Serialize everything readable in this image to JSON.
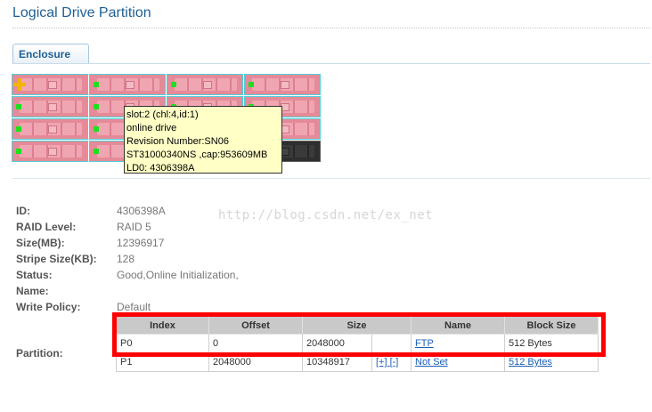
{
  "page": {
    "title": "Logical Drive Partition"
  },
  "tabs": [
    {
      "label": "Enclosure"
    }
  ],
  "colors": {
    "highlight": "#ff0000",
    "link": "#1a5fb4",
    "title": "#1f5f95",
    "drive_led": "#1ee01e",
    "add_marker": "#f3b400"
  },
  "tooltip": {
    "lines": [
      "slot:2 (chl:4,id:1)",
      "online drive",
      "Revision Number:SN06",
      "ST31000340NS ,cap:953609MB",
      "LD0: 4306398A"
    ]
  },
  "watermark": "http://blog.csdn.net/ex_net",
  "drive_info": [
    {
      "label": "ID:",
      "value": "4306398A"
    },
    {
      "label": "RAID Level:",
      "value": "RAID 5"
    },
    {
      "label": "Size(MB):",
      "value": "12396917"
    },
    {
      "label": "Stripe Size(KB):",
      "value": "128"
    },
    {
      "label": "Status:",
      "value": "Good,Online Initialization,"
    },
    {
      "label": "Name:",
      "value": ""
    },
    {
      "label": "Write Policy:",
      "value": "Default"
    }
  ],
  "partition": {
    "label": "Partition:",
    "columns": [
      "Index",
      "Offset",
      "Size",
      "Name",
      "Block Size"
    ],
    "rows": [
      {
        "index": "P0",
        "offset": "0",
        "size": "2048000",
        "controls": "",
        "name": "FTP",
        "block_size": "512 Bytes"
      },
      {
        "index": "P1",
        "offset": "2048000",
        "size": "10348917",
        "controls": "[+] [-]",
        "name": "Not Set",
        "block_size": "512 Bytes"
      }
    ]
  }
}
